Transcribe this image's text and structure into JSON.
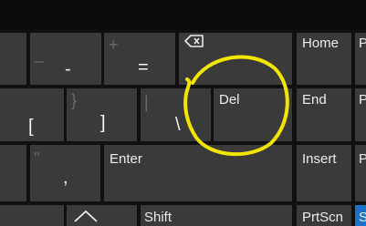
{
  "keyboard": {
    "row1": {
      "minus": {
        "shifted": "_",
        "base": "-"
      },
      "equals": {
        "shifted": "+",
        "base": "="
      },
      "backspace": {
        "icon": "backspace-icon"
      },
      "home": "Home",
      "pgup_partial": "P"
    },
    "row2": {
      "bracket_left": {
        "shifted": "",
        "base": "["
      },
      "bracket_right": {
        "shifted": "}",
        "base": "]"
      },
      "backslash": {
        "shifted": "|",
        "base": "\\"
      },
      "del": "Del",
      "end": "End",
      "pgdn_partial": "P"
    },
    "row3": {
      "quote": {
        "shifted": "\"",
        "base": ","
      },
      "enter": "Enter",
      "insert": "Insert",
      "partial": "P"
    },
    "row4": {
      "up_icon": "caret-up-icon",
      "shift": "Shift",
      "prtscn": "PrtScn",
      "partial": "S"
    }
  },
  "annotation": {
    "color": "#f2e600"
  },
  "colors": {
    "key": "#3a3a3a",
    "background": "#101010",
    "accent": "#1b73c9"
  }
}
